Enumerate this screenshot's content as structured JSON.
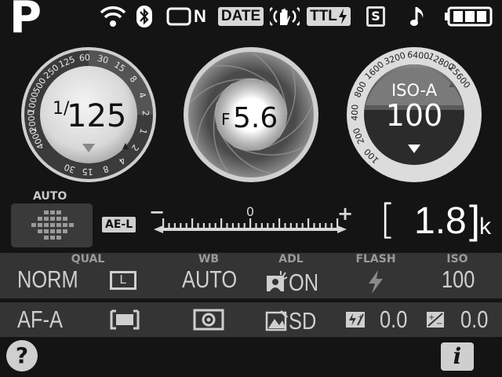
{
  "status_bar": {
    "mode": "P",
    "eye_fi_icon": "wifi-icon",
    "bluetooth_icon": "bluetooth-icon",
    "nef_icon": "image-comment-icon",
    "nef_label": "N",
    "date_label": "DATE",
    "vr_icon": "vibration-reduction-icon",
    "flash_mode_label": "TTL",
    "s_label": "S",
    "beep_icon": "music-note-icon",
    "battery_icon": "battery-icon"
  },
  "shutter_dial": {
    "value_prefix": "1/",
    "value": "125",
    "scale_labels": [
      "4000",
      "2000",
      "1000",
      "500",
      "250",
      "125",
      "60",
      "30",
      "15",
      "8",
      "4",
      "2",
      "1",
      "2",
      "4",
      "8",
      "15",
      "30"
    ]
  },
  "aperture_dial": {
    "prefix": "F",
    "value": "5.6"
  },
  "iso_dial": {
    "label": "ISO-A",
    "value": "100",
    "scale_labels": [
      "25600",
      "12800",
      "6400",
      "3200",
      "1600",
      "800",
      "400",
      "200",
      "100"
    ]
  },
  "meter_row": {
    "af_area_label": "AUTO",
    "ael_label": "AE-L",
    "minus": "−",
    "zero": "0",
    "plus": "+",
    "bracket": "[",
    "shots_remaining": "1.8",
    "shots_unit": "k"
  },
  "settings_row1": {
    "headers": [
      "QUAL",
      "WB",
      "ADL",
      "FLASH",
      "ISO"
    ],
    "quality": "NORM",
    "image_size_label": "L",
    "wb": "AUTO",
    "adl": "ON",
    "flash_icon": "flash-icon",
    "iso": "100"
  },
  "settings_row2": {
    "af_mode": "AF-A",
    "af_area_icon": "af-area-icon",
    "metering_icon": "metering-icon",
    "picture_control": "SD",
    "flash_comp": "0.0",
    "exposure_comp": "0.0"
  },
  "bottom_bar": {
    "help_label": "?",
    "info_label": "i"
  },
  "colors": {
    "background": "#141414",
    "panel_band": "#3a3a3a",
    "text_light": "#cfcfcf",
    "accent_white": "#ffffff"
  }
}
